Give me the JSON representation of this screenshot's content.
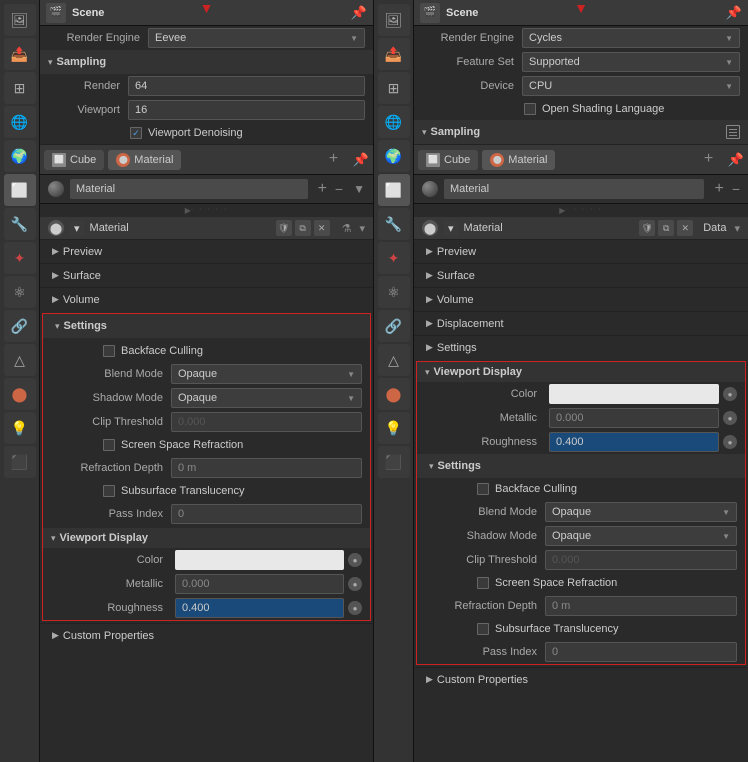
{
  "left_panel": {
    "header": {
      "title": "Scene",
      "pin_icon": "📌"
    },
    "render_engine_label": "Render Engine",
    "render_engine_value": "Eevee",
    "sampling": {
      "title": "Sampling",
      "render_label": "Render",
      "render_value": "64",
      "viewport_label": "Viewport",
      "viewport_value": "16",
      "denoising_label": "Viewport Denoising"
    },
    "object_tab": {
      "cube_label": "Cube",
      "material_label": "Material"
    },
    "material_name": "Material",
    "sections": {
      "preview": "Preview",
      "surface": "Surface",
      "volume": "Volume",
      "settings": "Settings"
    },
    "settings": {
      "backface_culling": "Backface Culling",
      "blend_mode_label": "Blend Mode",
      "blend_mode_value": "Opaque",
      "shadow_mode_label": "Shadow Mode",
      "shadow_mode_value": "Opaque",
      "clip_threshold_label": "Clip Threshold",
      "clip_threshold_value": "0.000",
      "ssr_label": "Screen Space Refraction",
      "refraction_depth_label": "Refraction Depth",
      "refraction_depth_value": "0 m",
      "subsurface_label": "Subsurface Translucency",
      "pass_index_label": "Pass Index",
      "pass_index_value": "0"
    },
    "viewport_display": {
      "title": "Viewport Display",
      "color_label": "Color",
      "metallic_label": "Metallic",
      "metallic_value": "0.000",
      "roughness_label": "Roughness",
      "roughness_value": "0.400"
    },
    "custom_properties": "Custom Properties"
  },
  "right_panel": {
    "header": {
      "title": "Scene",
      "pin_icon": "📌"
    },
    "render_engine_label": "Render Engine",
    "render_engine_value": "Cycles",
    "feature_set_label": "Feature Set",
    "feature_set_value": "Supported",
    "device_label": "Device",
    "device_value": "CPU",
    "osl_label": "Open Shading Language",
    "sampling": {
      "title": "Sampling",
      "list_icon": "≡"
    },
    "object_tab": {
      "cube_label": "Cube",
      "material_label": "Material"
    },
    "material_name": "Material",
    "sections": {
      "preview": "Preview",
      "surface": "Surface",
      "volume": "Volume",
      "displacement": "Displacement",
      "settings": "Settings"
    },
    "viewport_display": {
      "title": "Viewport Display",
      "color_label": "Color",
      "metallic_label": "Metallic",
      "metallic_value": "0.000",
      "roughness_label": "Roughness",
      "roughness_value": "0.400"
    },
    "settings": {
      "backface_culling": "Backface Culling",
      "blend_mode_label": "Blend Mode",
      "blend_mode_value": "Opaque",
      "shadow_mode_label": "Shadow Mode",
      "shadow_mode_value": "Opaque",
      "clip_threshold_label": "Clip Threshold",
      "clip_threshold_value": "0.000",
      "ssr_label": "Screen Space Refraction",
      "refraction_depth_label": "Refraction Depth",
      "refraction_depth_value": "0 m",
      "subsurface_label": "Subsurface Translucency",
      "pass_index_label": "Pass Index",
      "pass_index_value": "0"
    },
    "custom_properties": "Custom Properties"
  },
  "icons": {
    "scene": "🎬",
    "camera": "📷",
    "render": "🖼",
    "output": "📤",
    "view_layer": "⊞",
    "scene2": "🌐",
    "world": "🌍",
    "object": "⬜",
    "modifier": "🔧",
    "particles": "✦",
    "physics": "⚛",
    "constraints": "🔗",
    "data": "△",
    "material": "⬤",
    "shading": "💡",
    "texture": "⬛",
    "arrow_down": "▼",
    "arrow_right": "▶",
    "arrow_down_small": "▾",
    "checkbox_checked": "✓"
  }
}
